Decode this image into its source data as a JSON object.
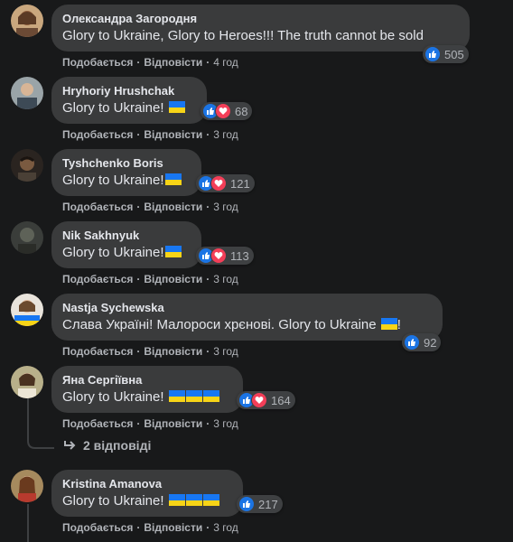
{
  "actions": {
    "like": "Подобається",
    "reply": "Відповісти",
    "sep": "·"
  },
  "comments": [
    {
      "author": "Олександра Загородня",
      "text": "Glory to Ukraine, Glory to Heroes!!! The truth cannot be sold",
      "reactions": [
        "like"
      ],
      "count": "505",
      "time": "4 год"
    },
    {
      "author": "Hryhoriy Hrushchak",
      "text": "Glory to Ukraine! ",
      "reactions": [
        "like",
        "love"
      ],
      "count": "68",
      "time": "3 год"
    },
    {
      "author": "Tyshchenko Boris",
      "text": "Glory to Ukraine!",
      "reactions": [
        "like",
        "love"
      ],
      "count": "121",
      "time": "3 год"
    },
    {
      "author": "Nik Sakhnyuk",
      "text": "Glory to Ukraine!",
      "reactions": [
        "like",
        "love"
      ],
      "count": "113",
      "time": "3 год"
    },
    {
      "author": "Nastja Sychewska",
      "text": "Слава Україні! Малороси хрєнові. Glory to Ukraine ",
      "text_end": "!",
      "reactions": [
        "like"
      ],
      "count": "92",
      "time": "3 год"
    },
    {
      "author": "Яна Сергіївна",
      "text": "Glory to Ukraine! ",
      "reactions": [
        "like",
        "love"
      ],
      "count": "164",
      "time": "3 год"
    },
    {
      "author": "Kristina Amanova",
      "text": "Glory to Ukraine! ",
      "reactions": [
        "like"
      ],
      "count": "217",
      "time": "3 год"
    }
  ],
  "replies_link": "2 відповіді",
  "colors": {
    "background": "#18191a",
    "bubble": "#3a3b3c",
    "like": "#1b74e4",
    "love": "#f33e58",
    "flag_blue": "#1877f2",
    "flag_yellow": "#f7d417"
  }
}
